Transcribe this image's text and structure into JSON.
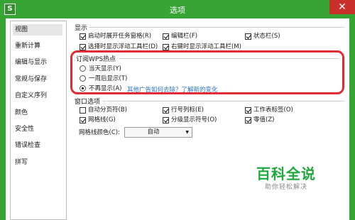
{
  "window": {
    "title": "选项",
    "app_icon": "S",
    "close_label": "✕"
  },
  "sidebar": {
    "items": [
      {
        "label": "视图",
        "selected": true
      },
      {
        "label": "重新计算"
      },
      {
        "label": "编辑与显示"
      },
      {
        "label": "常规与保存"
      },
      {
        "label": "自定义序列"
      },
      {
        "label": "颜色"
      },
      {
        "label": "安全性"
      },
      {
        "label": "错误检查"
      },
      {
        "label": "拼写"
      }
    ]
  },
  "display": {
    "title": "显示",
    "options": [
      {
        "label": "启动时展开任务窗格(R)",
        "checked": true
      },
      {
        "label": "编辑栏(F)",
        "checked": true
      },
      {
        "label": "状态栏(S)",
        "checked": true
      },
      {
        "label": "选择时显示浮动工具栏(D)",
        "checked": true
      },
      {
        "label": "右键时显示浮动工具栏(M)",
        "checked": true
      }
    ]
  },
  "wps_hot": {
    "title": "订阅WPS热点",
    "options": [
      {
        "label": "当天显示(Y)",
        "selected": false
      },
      {
        "label": "一周后显示(T)",
        "selected": false
      },
      {
        "label": "不再显示(A)",
        "selected": true
      }
    ],
    "link_text": "其他广告如何去除？了解新的变化"
  },
  "window_options": {
    "title": "窗口选项",
    "options": [
      {
        "label": "自动分页符(B)",
        "checked": false
      },
      {
        "label": "行号列标(E)",
        "checked": true
      },
      {
        "label": "工作表标签(O)",
        "checked": true
      },
      {
        "label": "网格线(G)",
        "checked": true
      },
      {
        "label": "分级显示符号(O)",
        "checked": true
      },
      {
        "label": "零值(Z)",
        "checked": true
      }
    ],
    "gridline_color_label": "网格线颜色(C):",
    "gridline_color_value": "自动"
  },
  "watermark": {
    "main": "百科全说",
    "sub": "助你轻松解决"
  },
  "colors": {
    "title_bar": "#37a533",
    "close_button": "#c9302c",
    "highlight": "#e32b35",
    "link": "#2a72c8",
    "watermark": "#1fa83b"
  }
}
